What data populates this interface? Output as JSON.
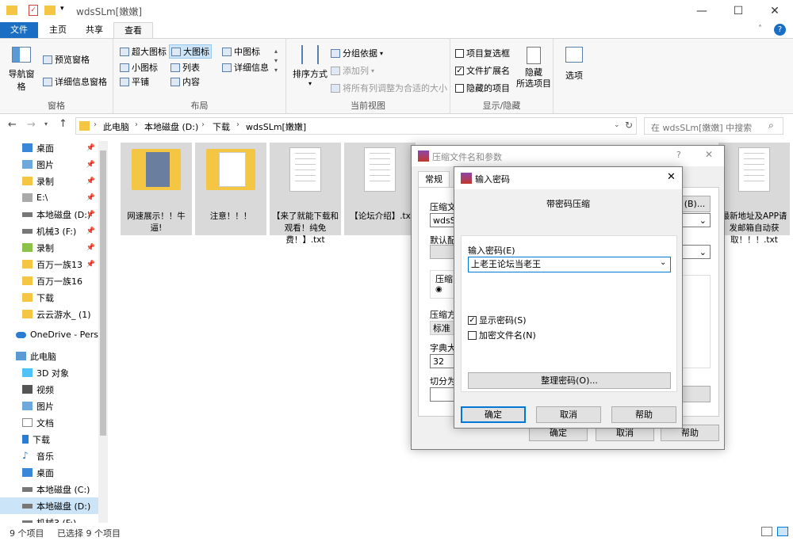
{
  "window": {
    "title": "wdsSLm[嫩嫩]",
    "minimize": "—",
    "maximize": "☐",
    "close": "✕"
  },
  "tabs": [
    "文件",
    "主页",
    "共享",
    "查看"
  ],
  "ribbon": {
    "panes": {
      "label": "窗格",
      "nav_pane": "导航窗格",
      "preview": "预览窗格",
      "details": "详细信息窗格"
    },
    "layout": {
      "label": "布局",
      "items": [
        "超大图标",
        "大图标",
        "中图标",
        "小图标",
        "列表",
        "详细信息",
        "平铺",
        "内容"
      ]
    },
    "current_view": {
      "label": "当前视图",
      "sort": "排序方式",
      "group": "分组依据",
      "add_col": "添加列",
      "fit_cols": "将所有列调整为合适的大小"
    },
    "show_hide": {
      "label": "显示/隐藏",
      "item_checkbox": "项目复选框",
      "file_ext": "文件扩展名",
      "hidden_items": "隐藏的项目",
      "hide_selected": "隐藏",
      "hide_selected2": "所选项目",
      "options": "选项"
    }
  },
  "address": {
    "path": [
      "此电脑",
      "本地磁盘 (D:)",
      "下载",
      "wdsSLm[嫩嫩]"
    ],
    "search_placeholder": "在 wdsSLm[嫩嫩] 中搜索"
  },
  "nav": {
    "quick": [
      "桌面",
      "图片",
      "录制",
      "E:\\",
      "本地磁盘 (D:)",
      "机械3 (F:)",
      "录制",
      "百万一族13",
      "百万一族16",
      "下载",
      "云云游水_ (1)"
    ],
    "onedrive": "OneDrive - Perso",
    "pc": "此电脑",
    "pc_items": [
      "3D 对象",
      "视频",
      "图片",
      "文档",
      "下载",
      "音乐",
      "桌面",
      "本地磁盘 (C:)",
      "本地磁盘 (D:)",
      "机械3 (F:)"
    ]
  },
  "files": [
    "网速展示！！牛逼!",
    "注意！！！",
    "【来了就能下载和观看！纯免费！】.txt",
    "【论坛介绍】.txt",
    "最新地址及APP请发邮箱自动获取！！！.txt"
  ],
  "status": {
    "count": "9 个项目",
    "selected": "已选择 9 个项目"
  },
  "archive_dialog": {
    "title": "压缩文件名和参数",
    "help": "?",
    "tab": "常规",
    "archive_name_label": "压缩文",
    "archive_name_value": "wdsSL",
    "browse": "(B)...",
    "profile_label": "默认配",
    "format_label": "压缩",
    "method_label": "压缩方",
    "method_value": "标准",
    "dict_label": "字典大",
    "dict_value": "32",
    "split_label": "切分为",
    "ok": "确定",
    "cancel": "取消",
    "help_btn": "帮助"
  },
  "password_dialog": {
    "title": "输入密码",
    "heading": "带密码压缩",
    "pw_label": "输入密码(E)",
    "pw_value": "上老王论坛当老王",
    "show_pw": "显示密码(S)",
    "encrypt_names": "加密文件名(N)",
    "organize": "整理密码(O)...",
    "ok": "确定",
    "cancel": "取消",
    "help": "帮助",
    "close": "✕"
  }
}
